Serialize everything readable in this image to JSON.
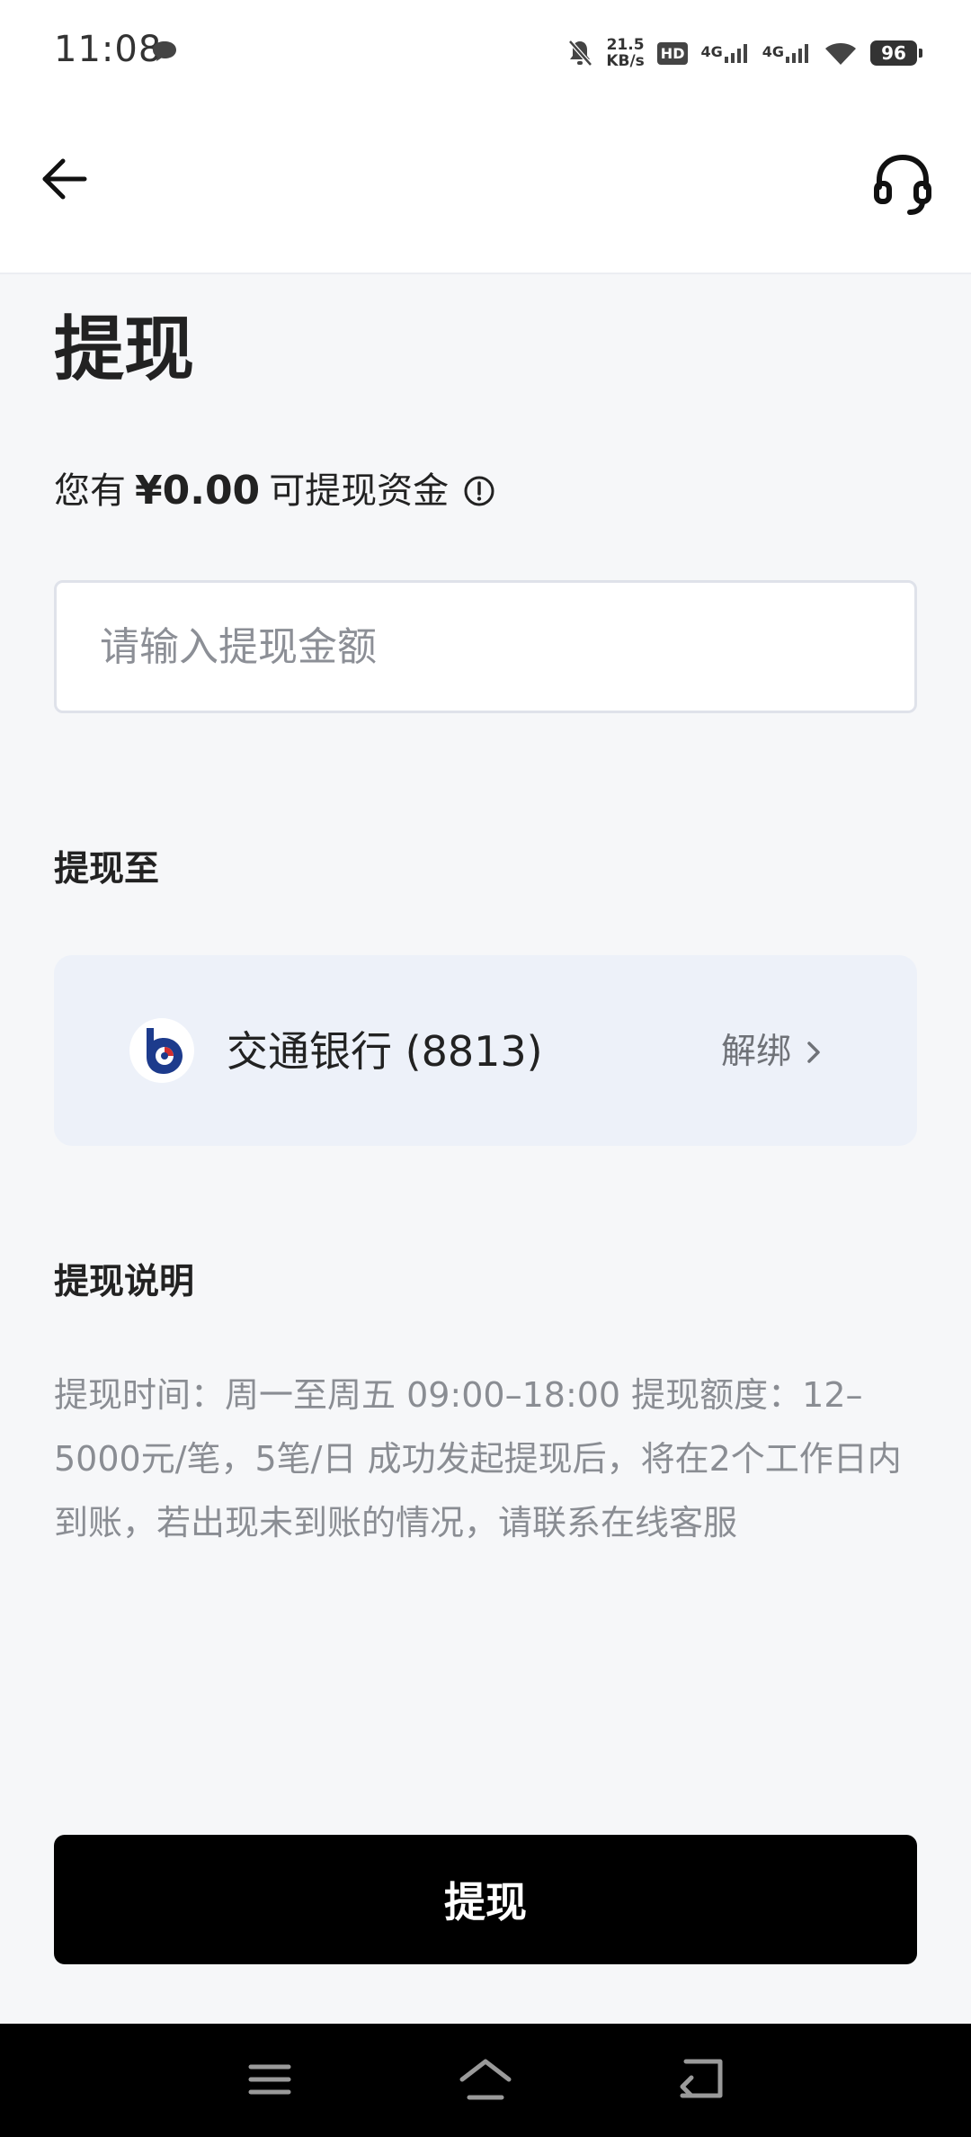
{
  "status_bar": {
    "time": "11:08",
    "net_speed_value": "21.5",
    "net_speed_unit": "KB/s",
    "hd_label": "HD",
    "signal1_label": "4G",
    "signal2_label": "4G",
    "battery_level": "96",
    "icons": [
      "message-icon",
      "mute-bell-icon",
      "hd-icon",
      "signal-icon",
      "signal-icon",
      "wifi-icon",
      "battery-icon"
    ]
  },
  "header": {
    "icons": [
      "back-arrow-icon",
      "headset-icon"
    ]
  },
  "page": {
    "title": "提现",
    "balance_prefix": "您有",
    "balance_amount": "¥0.00",
    "balance_suffix": "可提现资金",
    "balance_info_icon": "info-circle-icon"
  },
  "amount_input": {
    "placeholder": "请输入提现金额",
    "value": ""
  },
  "withdraw_to": {
    "label": "提现至",
    "bank_name": "交通银行 (8813)",
    "bank_icon": "bank-of-communications-logo",
    "unbind_label": "解绑",
    "unbind_icon": "chevron-right-icon"
  },
  "instructions": {
    "label": "提现说明",
    "text": "提现时间：周一至周五 09:00–18:00 提现额度：12–5000元/笔，5笔/日 成功发起提现后，将在2个工作日内到账，若出现未到账的情况，请联系在线客服"
  },
  "submit": {
    "label": "提现"
  },
  "nav_bar": {
    "icons": [
      "menu-icon",
      "home-icon",
      "back-icon"
    ]
  },
  "colors": {
    "page_background": "#f6f7f9",
    "card_background": "#edf1f9",
    "primary_button": "#000000",
    "muted_text": "#8a8d93",
    "bank_logo_blue": "#1d3b8c"
  }
}
